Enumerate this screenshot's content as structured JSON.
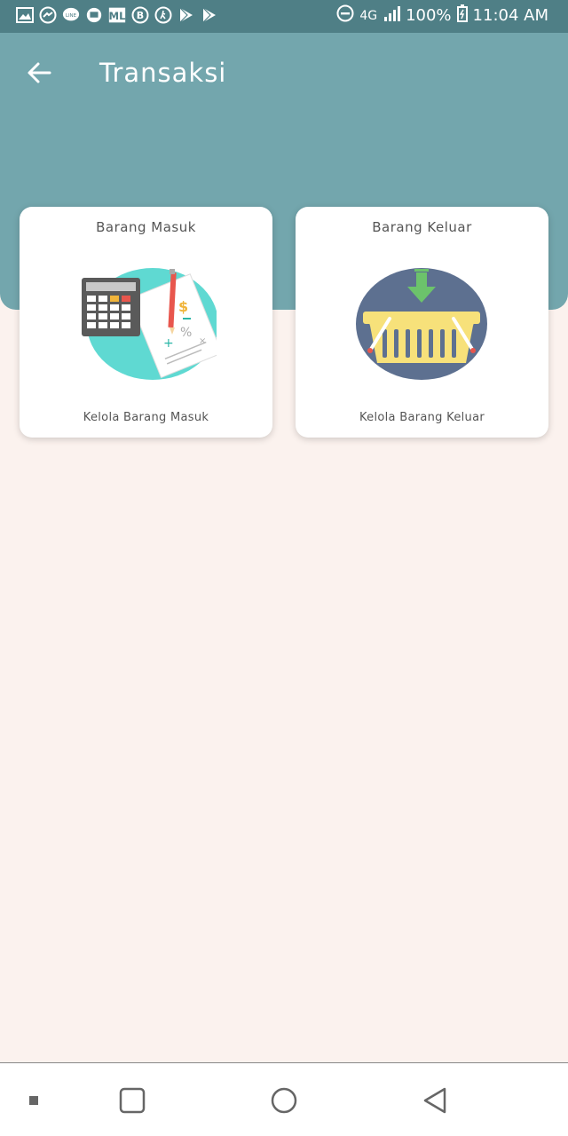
{
  "status_bar": {
    "network": "4G",
    "battery": "100%",
    "time": "11:04 AM",
    "icons": [
      "gallery-icon",
      "messenger-icon",
      "line-icon",
      "chat-icon",
      "ml-icon",
      "b-icon",
      "walk-icon",
      "play-store-icon",
      "play-store-icon"
    ]
  },
  "header": {
    "title": "Transaksi",
    "color": "#73a6ad"
  },
  "cards": [
    {
      "title": "Barang Masuk",
      "subtitle": "Kelola Barang Masuk",
      "icon": "calculator-icon"
    },
    {
      "title": "Barang Keluar",
      "subtitle": "Kelola Barang Keluar",
      "icon": "basket-icon"
    }
  ],
  "colors": {
    "background": "#fbf2ee",
    "status_bar": "#4f7f86"
  }
}
